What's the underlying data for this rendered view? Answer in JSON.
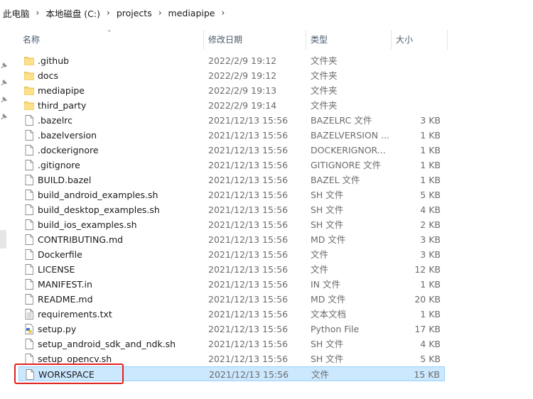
{
  "breadcrumb": [
    "此电脑",
    "本地磁盘 (C:)",
    "projects",
    "mediapipe"
  ],
  "columns": {
    "name": "名称",
    "date": "修改日期",
    "type": "类型",
    "size": "大小"
  },
  "files": [
    {
      "name": ".github",
      "date": "2022/2/9 19:12",
      "type": "文件夹",
      "size": "",
      "icon": "folder-icon"
    },
    {
      "name": "docs",
      "date": "2022/2/9 19:12",
      "type": "文件夹",
      "size": "",
      "icon": "folder-icon"
    },
    {
      "name": "mediapipe",
      "date": "2022/2/9 19:13",
      "type": "文件夹",
      "size": "",
      "icon": "folder-icon"
    },
    {
      "name": "third_party",
      "date": "2022/2/9 19:14",
      "type": "文件夹",
      "size": "",
      "icon": "folder-icon"
    },
    {
      "name": ".bazelrc",
      "date": "2021/12/13 15:56",
      "type": "BAZELRC 文件",
      "size": "3 KB",
      "icon": "file-icon"
    },
    {
      "name": ".bazelversion",
      "date": "2021/12/13 15:56",
      "type": "BAZELVERSION ...",
      "size": "1 KB",
      "icon": "file-icon"
    },
    {
      "name": ".dockerignore",
      "date": "2021/12/13 15:56",
      "type": "DOCKERIGNOR...",
      "size": "1 KB",
      "icon": "file-icon"
    },
    {
      "name": ".gitignore",
      "date": "2021/12/13 15:56",
      "type": "GITIGNORE 文件",
      "size": "1 KB",
      "icon": "file-icon"
    },
    {
      "name": "BUILD.bazel",
      "date": "2021/12/13 15:56",
      "type": "BAZEL 文件",
      "size": "1 KB",
      "icon": "file-icon"
    },
    {
      "name": "build_android_examples.sh",
      "date": "2021/12/13 15:56",
      "type": "SH 文件",
      "size": "5 KB",
      "icon": "file-icon"
    },
    {
      "name": "build_desktop_examples.sh",
      "date": "2021/12/13 15:56",
      "type": "SH 文件",
      "size": "4 KB",
      "icon": "file-icon"
    },
    {
      "name": "build_ios_examples.sh",
      "date": "2021/12/13 15:56",
      "type": "SH 文件",
      "size": "2 KB",
      "icon": "file-icon"
    },
    {
      "name": "CONTRIBUTING.md",
      "date": "2021/12/13 15:56",
      "type": "MD 文件",
      "size": "3 KB",
      "icon": "file-icon"
    },
    {
      "name": "Dockerfile",
      "date": "2021/12/13 15:56",
      "type": "文件",
      "size": "3 KB",
      "icon": "file-icon"
    },
    {
      "name": "LICENSE",
      "date": "2021/12/13 15:56",
      "type": "文件",
      "size": "12 KB",
      "icon": "file-icon"
    },
    {
      "name": "MANIFEST.in",
      "date": "2021/12/13 15:56",
      "type": "IN 文件",
      "size": "1 KB",
      "icon": "file-icon"
    },
    {
      "name": "README.md",
      "date": "2021/12/13 15:56",
      "type": "MD 文件",
      "size": "20 KB",
      "icon": "file-icon"
    },
    {
      "name": "requirements.txt",
      "date": "2021/12/13 15:56",
      "type": "文本文档",
      "size": "1 KB",
      "icon": "text-file-icon"
    },
    {
      "name": "setup.py",
      "date": "2021/12/13 15:56",
      "type": "Python File",
      "size": "17 KB",
      "icon": "python-file-icon"
    },
    {
      "name": "setup_android_sdk_and_ndk.sh",
      "date": "2021/12/13 15:56",
      "type": "SH 文件",
      "size": "4 KB",
      "icon": "file-icon"
    },
    {
      "name": "setup_opencv.sh",
      "date": "2021/12/13 15:56",
      "type": "SH 文件",
      "size": "5 KB",
      "icon": "file-icon"
    },
    {
      "name": "WORKSPACE",
      "date": "2021/12/13 15:56",
      "type": "文件",
      "size": "15 KB",
      "icon": "file-icon",
      "selected": true
    }
  ],
  "colors": {
    "selection": "#cce8ff",
    "selection_border": "#99d1ff",
    "highlight": "#e02020",
    "folder": "#f8d775"
  }
}
